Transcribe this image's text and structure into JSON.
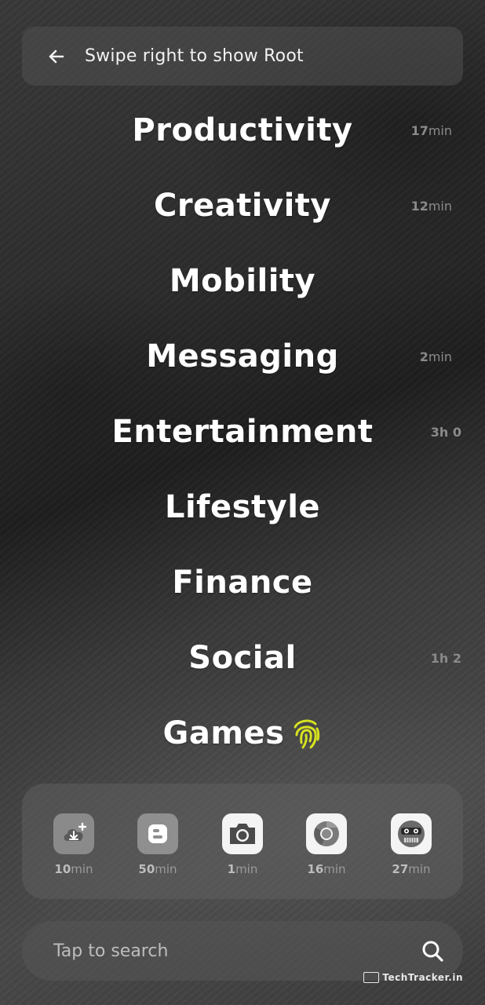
{
  "header": {
    "back_icon": "arrow-left-icon",
    "hint": "Swipe right to show Root"
  },
  "categories": [
    {
      "name": "Productivity",
      "time_num": "17",
      "time_unit": "min"
    },
    {
      "name": "Creativity",
      "time_num": "12",
      "time_unit": "min"
    },
    {
      "name": "Mobility",
      "time_num": "",
      "time_unit": ""
    },
    {
      "name": "Messaging",
      "time_num": "2",
      "time_unit": "min"
    },
    {
      "name": "Entertainment",
      "time_num": "3h 0",
      "time_unit": ""
    },
    {
      "name": "Lifestyle",
      "time_num": "",
      "time_unit": ""
    },
    {
      "name": "Finance",
      "time_num": "",
      "time_unit": ""
    },
    {
      "name": "Social",
      "time_num": "1h 2",
      "time_unit": ""
    },
    {
      "name": "Games",
      "time_num": "",
      "time_unit": ""
    }
  ],
  "dock": {
    "apps": [
      {
        "icon": "cloud-download-icon",
        "usage_num": "10",
        "usage_unit": "min"
      },
      {
        "icon": "blogger-icon",
        "usage_num": "50",
        "usage_unit": "min"
      },
      {
        "icon": "camera-icon",
        "usage_num": "1",
        "usage_unit": "min"
      },
      {
        "icon": "chrome-icon",
        "usage_num": "16",
        "usage_unit": "min"
      },
      {
        "icon": "robot-face-icon",
        "usage_num": "27",
        "usage_unit": "min"
      }
    ]
  },
  "search": {
    "placeholder": "Tap to search",
    "icon": "search-icon"
  },
  "watermark": {
    "text": "TechTracker.in"
  },
  "colors": {
    "fingerprint": "#d7e21f",
    "time_text": "#8a8a8a"
  }
}
